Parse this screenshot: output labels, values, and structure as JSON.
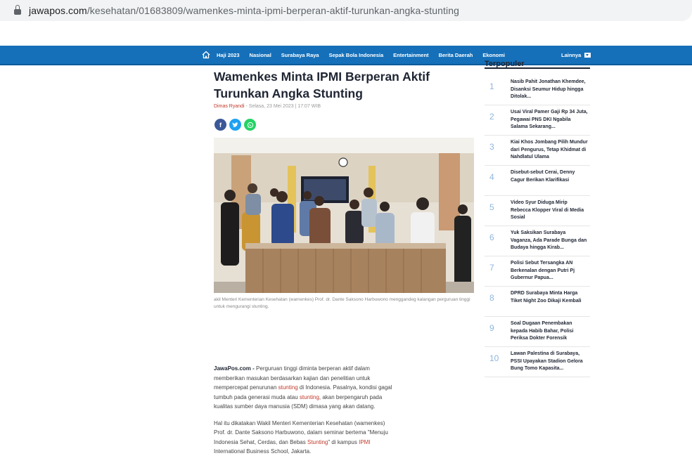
{
  "browser": {
    "url_host": "jawapos.com",
    "url_path": "/kesehatan/01683809/wamenkes-minta-ipmi-berperan-aktif-turunkan-angka-stunting"
  },
  "nav": {
    "items": [
      "Haji 2023",
      "Nasional",
      "Surabaya Raya",
      "Sepak Bola Indonesia",
      "Entertainment",
      "Berita Daerah",
      "Ekonomi"
    ],
    "more_label": "Lainnya"
  },
  "article": {
    "title": "Wamenkes Minta IPMI Berperan Aktif Turunkan Angka Stunting",
    "author": "Dimas Ryandi",
    "date": " - Selasa, 23 Mei 2023 | 17:07 WIB",
    "caption": "akil Menteri Kementerian Kesehatan (wamenkes) Prof. dr. Dante Saksono Harbuwono menggandeg kalangan perguruan tinggi untuk mengurangi stunting.",
    "p1_brand": "JawaPos.com - ",
    "p1_a": "Perguruan tinggi diminta berperan aktif dalam memberikan masukan berdasarkan kajian dan penelitian untuk mempercepat penurunan ",
    "p1_link1": "stunting",
    "p1_b": " di Indonesia. Pasalnya, kondisi gagal tumbuh pada generasi muda atau ",
    "p1_link2": "stunting",
    "p1_c": ", akan berpengaruh pada kualitas sumber daya manusia (SDM) dimasa yang akan datang.",
    "p2_a": "Hal itu dikatakan Wakil Menteri Kementerian Kesehatan (wamenkes) Prof. dr. Dante Saksono Harbuwono, dalam seminar bertema \"Menuju Indonesia Sehat, Cerdas, dan Bebas ",
    "p2_link1": "Stunting",
    "p2_b": "\" di kampus ",
    "p2_link2": "IPMI",
    "p2_c": " International Business School, Jakarta."
  },
  "sidebar": {
    "title": "Terpopuler",
    "items": [
      {
        "num": "1",
        "text": "Nasib Pahit Jonathan Khemdee, Disanksi Seumur Hidup hingga Ditolak..."
      },
      {
        "num": "2",
        "text": "Usai Viral Pamer Gaji Rp 34 Juta, Pegawai PNS DKI Ngabila Salama Sekarang..."
      },
      {
        "num": "3",
        "text": "Kiai Khos Jombang Pilih Mundur dari Pengurus, Tetap Khidmat di Nahdlatul Ulama"
      },
      {
        "num": "4",
        "text": "Disebut-sebut Cerai, Denny Cagur Berikan Klarifikasi"
      },
      {
        "num": "5",
        "text": "Video Syur Diduga Mirip Rebecca Klopper Viral di Media Sosial"
      },
      {
        "num": "6",
        "text": "Yuk Saksikan Surabaya Vaganza, Ada Parade Bunga dan Budaya hingga Kirab..."
      },
      {
        "num": "7",
        "text": "Polisi Sebut Tersangka AN Berkenalan dengan Putri Pj Gubernur Papua..."
      },
      {
        "num": "8",
        "text": "DPRD Surabaya Minta Harga Tiket Night Zoo Dikaji Kembali"
      },
      {
        "num": "9",
        "text": "Soal Dugaan Penembakan kepada Habib Bahar, Polisi Periksa Dokter Forensik"
      },
      {
        "num": "10",
        "text": "Lawan Palestina di Surabaya, PSSI Upayakan Stadion Gelora Bung Tomo Kapasita..."
      }
    ]
  }
}
